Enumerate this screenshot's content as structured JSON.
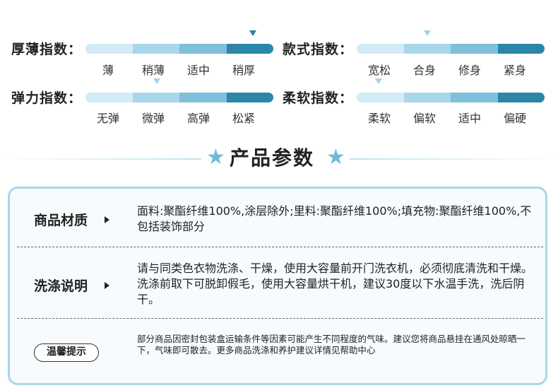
{
  "indices": [
    {
      "label": "厚薄指数：",
      "options": [
        "薄",
        "稍薄",
        "适中",
        "稍厚"
      ],
      "level": 4
    },
    {
      "label": "款式指数：",
      "options": [
        "宽松",
        "合身",
        "修身",
        "紧身"
      ],
      "level": 2
    },
    {
      "label": "弹力指数：",
      "options": [
        "无弹",
        "微弹",
        "高弹",
        "松紧"
      ],
      "level": 2
    },
    {
      "label": "柔软指数：",
      "options": [
        "柔软",
        "偏软",
        "适中",
        "偏硬"
      ],
      "level": 1
    }
  ],
  "section_title": "产品参数",
  "params": [
    {
      "label": "商品材质",
      "text": "面料:聚酯纤维100%,涂层除外;里料:聚酯纤维100%;填充物:聚酯纤维100%,不包括装饰部分"
    },
    {
      "label": "洗涤说明",
      "text": "请与同类色衣物洗涤、干燥，使用大容量前开门洗衣机，必须彻底清洗和干燥。 洗涤前取下可脱卸假毛，使用大容量烘干机，建议30度以下水温手洗，洗后阴干。"
    }
  ],
  "tip": {
    "label": "温馨提示",
    "text": "部分商品因密封包装盒运输条件等因素可能产生不同程度的气味。建议您将商品悬挂在通风处晾晒一下，气味即可散去。更多商品洗涤和养护建议详情见帮助中心"
  },
  "colors": {
    "accent": "#2b86a8",
    "light": "#a9d6ea"
  }
}
